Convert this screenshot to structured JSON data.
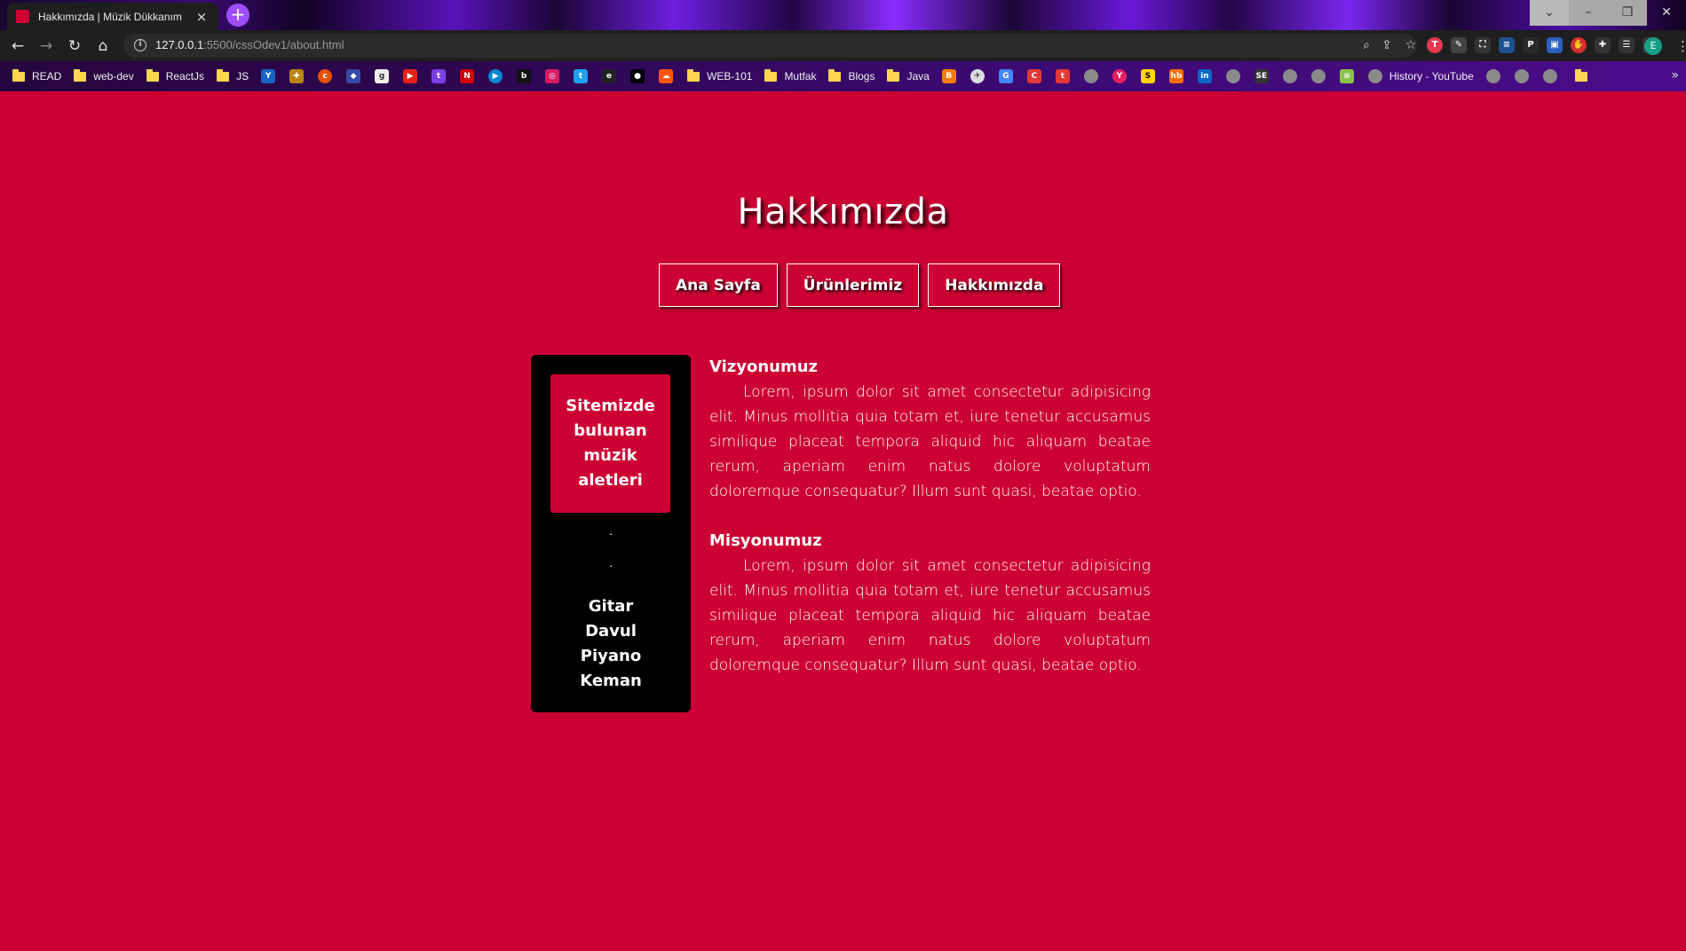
{
  "browser": {
    "tab_title": "Hakkımızda | Müzik Dükkanım",
    "tab_close": "×",
    "new_tab": "+",
    "url_host": "127.0.0.1",
    "url_path": ":5500/cssOdev1/about.html",
    "profile_initial": "E",
    "bookmarks": [
      {
        "label": "READ",
        "type": "folder"
      },
      {
        "label": "web-dev",
        "type": "folder"
      },
      {
        "label": "ReactJs",
        "type": "folder"
      },
      {
        "label": "JS",
        "type": "folder"
      },
      {
        "label": "WEB-101",
        "type": "folder"
      },
      {
        "label": "Mutfak",
        "type": "folder"
      },
      {
        "label": "Blogs",
        "type": "folder"
      },
      {
        "label": "Java",
        "type": "folder"
      },
      {
        "label": "History - YouTube",
        "type": "globe"
      }
    ]
  },
  "page": {
    "title": "Hakkımızda",
    "nav": [
      {
        "label": "Ana Sayfa"
      },
      {
        "label": "Ürünlerimiz"
      },
      {
        "label": "Hakkımızda"
      }
    ],
    "sidebar": {
      "heading_lines": [
        "Sitemizde",
        "bulunan",
        "müzik",
        "aletleri"
      ],
      "dot1": ".",
      "dot2": ".",
      "instruments": [
        "Gitar",
        "Davul",
        "Piyano",
        "Keman"
      ]
    },
    "sections": [
      {
        "title": "Vizyonumuz",
        "text": "Lorem, ipsum dolor sit amet consectetur adipisicing elit. Minus mollitia quia totam et, iure tenetur accusamus similique placeat tempora aliquid hic aliquam beatae rerum, aperiam enim natus dolore voluptatum doloremque consequatur? Illum sunt quasi, beatae optio."
      },
      {
        "title": "Misyonumuz",
        "text": "Lorem, ipsum dolor sit amet consectetur adipisicing elit. Minus mollitia quia totam et, iure tenetur accusamus similique placeat tempora aliquid hic aliquam beatae rerum, aperiam enim natus dolore voluptatum doloremque consequatur? Illum sunt quasi, beatae optio."
      }
    ]
  },
  "colors": {
    "page_bg": "#cc0033",
    "sidebar_bg": "#000000",
    "text": "#ffffff"
  }
}
